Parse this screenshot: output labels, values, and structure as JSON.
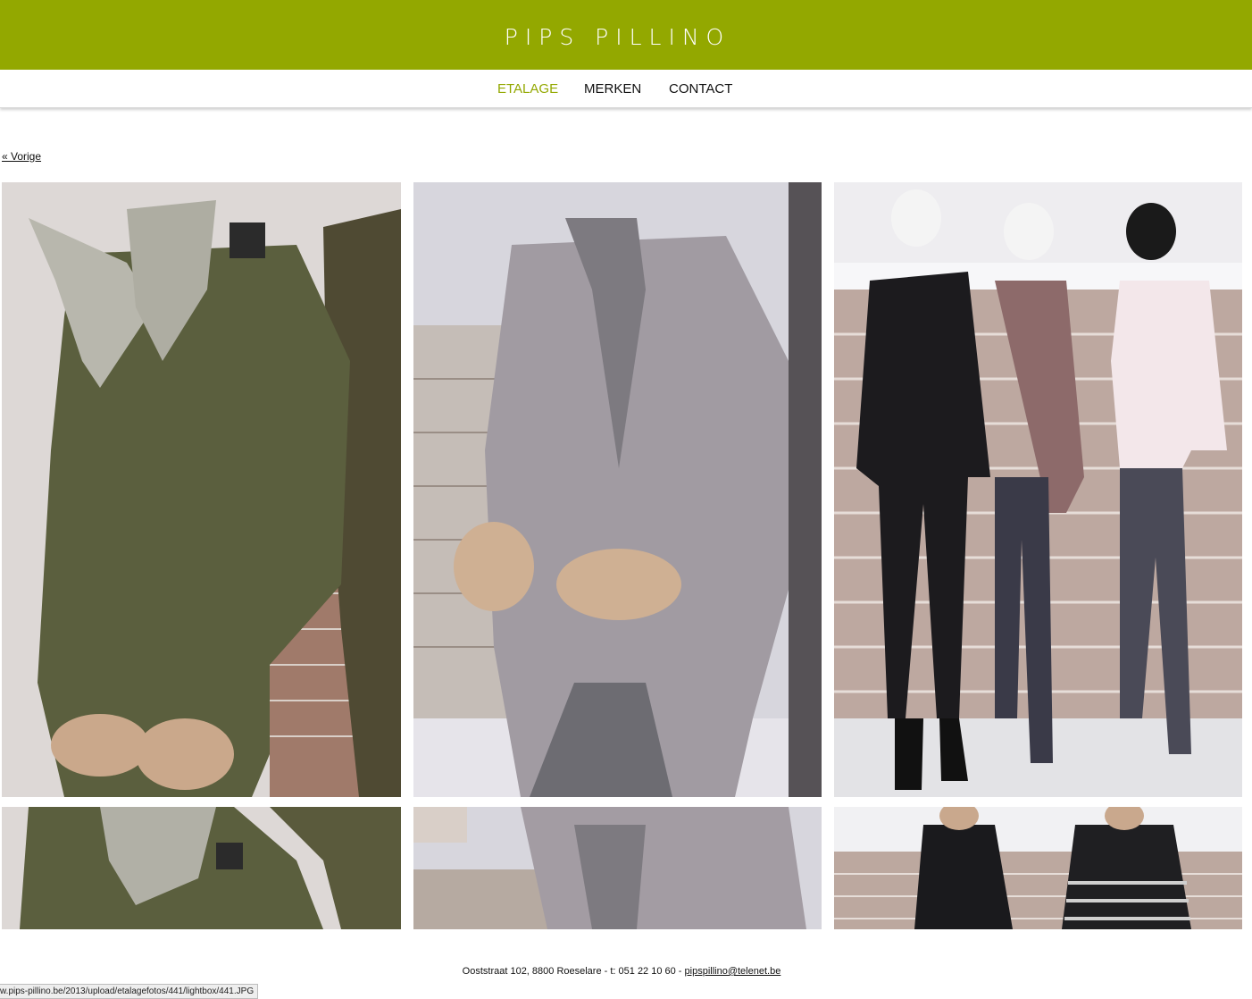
{
  "brand": {
    "logo_text": "PIPS PILLINO",
    "accent_color": "#93a800"
  },
  "nav": {
    "items": [
      {
        "label": "ETALAGE",
        "active": true
      },
      {
        "label": "MERKEN",
        "active": false
      },
      {
        "label": "CONTACT",
        "active": false
      }
    ]
  },
  "gallery": {
    "prev_label": "« Vorige",
    "photos": [
      {
        "subject": "mannequin-olive-knit-dress-leopard-scarf"
      },
      {
        "subject": "mannequin-grey-knit-cardigan-ruffle-blouse"
      },
      {
        "subject": "three-mannequins-brick-wall"
      },
      {
        "subject": "mannequin-olive-knit-dress-leopard-scarf-closeup"
      },
      {
        "subject": "mannequin-grey-cardigan-closeup"
      },
      {
        "subject": "two-mannequins-black-tops"
      }
    ]
  },
  "footer": {
    "address": "Ooststraat 102, 8800 Roeselare - t: 051 22 10 60 - ",
    "email": "pipspillino@telenet.be"
  },
  "status_bar": {
    "url": "w.pips-pillino.be/2013/upload/etalagefotos/441/lightbox/441.JPG"
  }
}
